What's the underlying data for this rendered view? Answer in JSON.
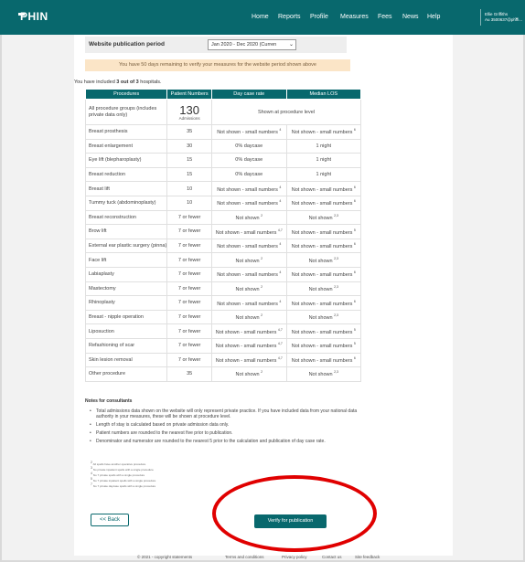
{
  "nav": {
    "logo": "PHIN",
    "links": [
      "Home",
      "Reports",
      "Profile",
      "Measures",
      "Fees",
      "News",
      "Help"
    ],
    "user_name": "Ellie Griffiths",
    "user_id": "Au 3500637@phin..."
  },
  "period": {
    "label": "Website publication period",
    "selected": "Jan 2020 - Dec 2020 (Curren"
  },
  "warning": "You have 50 days remaining to verify your measures for the website period shown above",
  "included": {
    "prefix": "You have included ",
    "count": "3 out of 3",
    "suffix": " hospitals."
  },
  "table": {
    "headers": [
      "Procedures",
      "Patient Numbers",
      "Day case rate",
      "Median LOS"
    ],
    "first_row": {
      "procedure": "All procedure groups (includes private data only)",
      "patients": "130",
      "patients_sub": "Admissions",
      "merged": "Shown at procedure level"
    },
    "rows": [
      {
        "p": "Breast prosthesis",
        "n": "35",
        "d": "Not shown - small numbers",
        "ds": "4",
        "m": "Not shown - small numbers",
        "ms": "6"
      },
      {
        "p": "Breast enlargement",
        "n": "30",
        "d": "0% daycase",
        "ds": "",
        "m": "1 night",
        "ms": ""
      },
      {
        "p": "Eye lift (blepharoplasty)",
        "n": "15",
        "d": "0% daycase",
        "ds": "",
        "m": "1 night",
        "ms": ""
      },
      {
        "p": "Breast reduction",
        "n": "15",
        "d": "0% daycase",
        "ds": "",
        "m": "1 night",
        "ms": ""
      },
      {
        "p": "Breast lift",
        "n": "10",
        "d": "Not shown - small numbers",
        "ds": "4",
        "m": "Not shown - small numbers",
        "ms": "6"
      },
      {
        "p": "Tummy tuck (abdominoplasty)",
        "n": "10",
        "d": "Not shown - small numbers",
        "ds": "4",
        "m": "Not shown - small numbers",
        "ms": "6"
      },
      {
        "p": "Breast reconstruction",
        "n": "7 or fewer",
        "d": "Not shown",
        "ds": "2",
        "m": "Not shown",
        "ms": "2,3"
      },
      {
        "p": "Brow lift",
        "n": "7 or fewer",
        "d": "Not shown - small numbers",
        "ds": "4,7",
        "m": "Not shown - small numbers",
        "ms": "5"
      },
      {
        "p": "External ear plastic surgery (pinna)",
        "n": "7 or fewer",
        "d": "Not shown - small numbers",
        "ds": "4",
        "m": "Not shown - small numbers",
        "ms": "6"
      },
      {
        "p": "Face lift",
        "n": "7 or fewer",
        "d": "Not shown",
        "ds": "2",
        "m": "Not shown",
        "ms": "2,3"
      },
      {
        "p": "Labiaplasty",
        "n": "7 or fewer",
        "d": "Not shown - small numbers",
        "ds": "4",
        "m": "Not shown - small numbers",
        "ms": "6"
      },
      {
        "p": "Mastectomy",
        "n": "7 or fewer",
        "d": "Not shown",
        "ds": "2",
        "m": "Not shown",
        "ms": "2,3"
      },
      {
        "p": "Rhinoplasty",
        "n": "7 or fewer",
        "d": "Not shown - small numbers",
        "ds": "4",
        "m": "Not shown - small numbers",
        "ms": "6"
      },
      {
        "p": "Breast - nipple operation",
        "n": "7 or fewer",
        "d": "Not shown",
        "ds": "2",
        "m": "Not shown",
        "ms": "2,3"
      },
      {
        "p": "Liposuction",
        "n": "7 or fewer",
        "d": "Not shown - small numbers",
        "ds": "4,7",
        "m": "Not shown - small numbers",
        "ms": "5"
      },
      {
        "p": "Refashioning of scar",
        "n": "7 or fewer",
        "d": "Not shown - small numbers",
        "ds": "4,7",
        "m": "Not shown - small numbers",
        "ms": "5"
      },
      {
        "p": "Skin lesion removal",
        "n": "7 or fewer",
        "d": "Not shown - small numbers",
        "ds": "4,7",
        "m": "Not shown - small numbers",
        "ms": "6"
      },
      {
        "p": "Other procedure",
        "n": "35",
        "d": "Not shown",
        "ds": "2",
        "m": "Not shown",
        "ms": "2,3"
      }
    ]
  },
  "notes": {
    "title": "Notes for consultants",
    "items": [
      "Total admissions data shown on the website will only represent private practice. If you have included data from your national data authority in your measures, these will be shown at procedure level.",
      "Length of stay is calculated based on private admission data only.",
      "Patient numbers are rounded to the nearest five prior to publication.",
      "Denominator and numerator are rounded to the nearest 5 prior to the calculation and publication of day case rate."
    ],
    "footnotes": [
      "All spells have another operative procedure",
      "No private inpatient spells with a single procedure",
      "No 7 private spells with a single procedure",
      "No 7 private inpatient spells with a single procedure",
      "No 7 private daycase spells with a single procedure"
    ]
  },
  "buttons": {
    "back": "<< Back",
    "verify": "Verify for publication"
  },
  "footer": {
    "copyright": "© 2021 - copyright statements",
    "links": [
      "Terms and conditions",
      "Privacy policy",
      "Contact us",
      "Site feedback"
    ]
  },
  "colors": {
    "brand": "#08686d",
    "warning_bg": "#fbe5c7",
    "annotation": "#e00000"
  }
}
